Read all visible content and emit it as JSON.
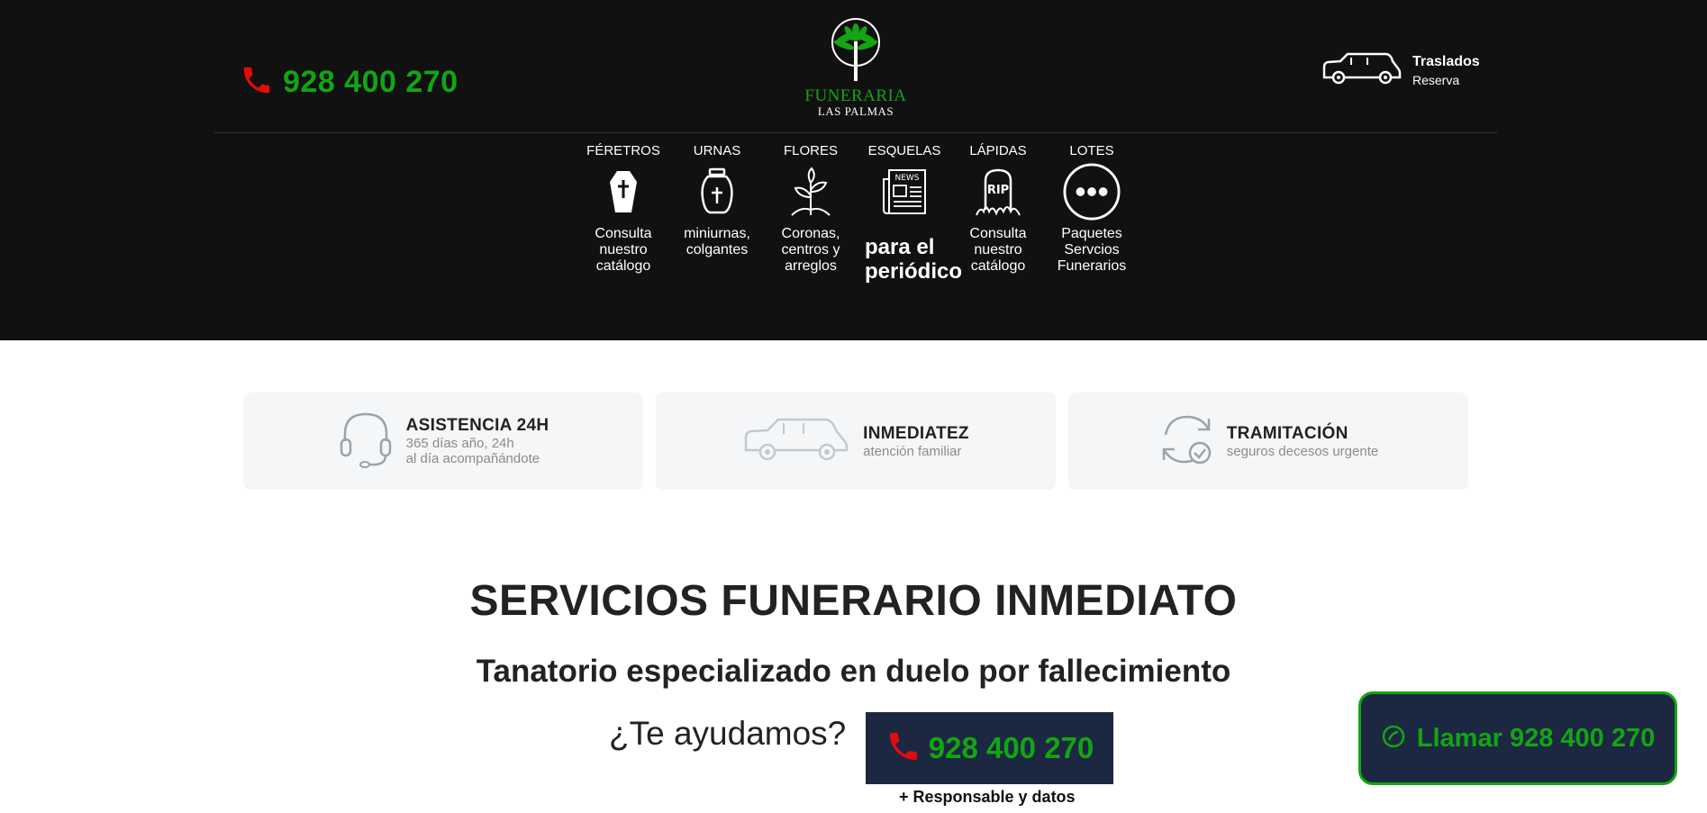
{
  "header": {
    "phone": "928 400 270",
    "logo": {
      "line1": "FUNERARIA",
      "line2": "LAS PALMAS"
    },
    "traslados": {
      "title": "Traslados",
      "subtitle": "Reserva"
    },
    "nav": [
      {
        "label": "FÉRETROS",
        "desc": "Consulta nuestro catálogo",
        "icon": "coffin-icon"
      },
      {
        "label": "URNAS",
        "desc": "miniurnas, colgantes",
        "icon": "urn-icon"
      },
      {
        "label": "FLORES",
        "desc": "Coronas, centros y arreglos",
        "icon": "plant-icon"
      },
      {
        "label": "ESQUELAS",
        "desc": "para el periódico",
        "icon": "newspaper-icon"
      },
      {
        "label": "LÁPIDAS",
        "desc": "Consulta nuestro catálogo",
        "icon": "tombstone-icon"
      },
      {
        "label": "LOTES",
        "desc": "Paquetes Servcios Funerarios",
        "icon": "more-icon"
      }
    ]
  },
  "features": [
    {
      "title": "ASISTENCIA 24H",
      "sub1": "365 días año, 24h",
      "sub2": "al día acompañándote",
      "icon": "headset-icon"
    },
    {
      "title": "INMEDIATEZ",
      "sub1": "atención familiar",
      "sub2": "",
      "icon": "hearse-icon"
    },
    {
      "title": "TRAMITACIÓN",
      "sub1": "seguros decesos urgente",
      "sub2": "",
      "icon": "refresh-check-icon"
    }
  ],
  "main": {
    "title": "SERVICIOS FUNERARIO INMEDIATO",
    "subtitle": "Tanatorio especializado en duelo por fallecimiento",
    "ask": "¿Te ayudamos?",
    "phone": "928 400 270",
    "responsable": "+ Responsable y datos"
  },
  "call_button": {
    "label": "Llamar 928 400 270"
  },
  "colors": {
    "green": "#13a513",
    "navy": "#1c2742",
    "red_phone": "#e30b0b",
    "header_bg": "#111111"
  }
}
